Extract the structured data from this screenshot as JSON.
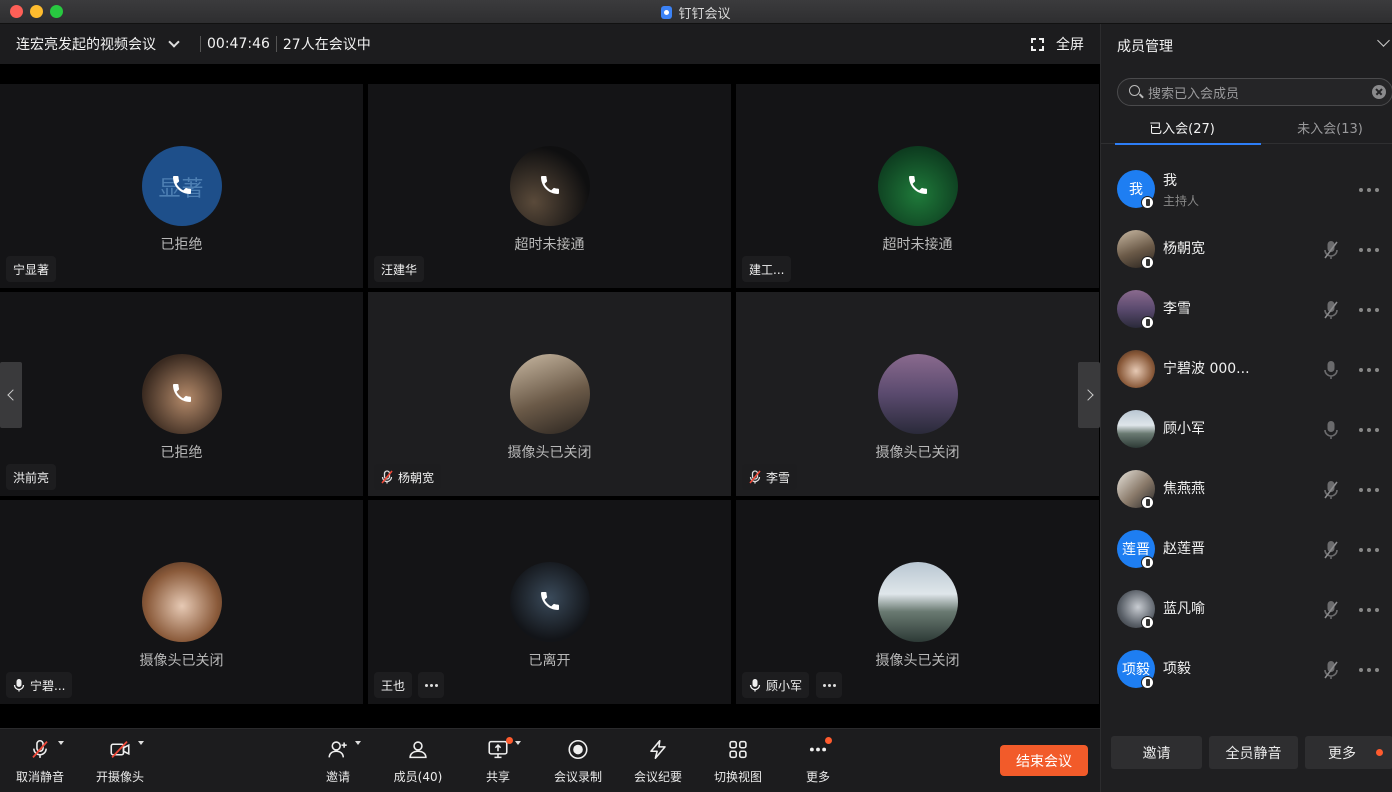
{
  "window": {
    "title": "钉钉会议"
  },
  "header": {
    "meeting_title": "连宏亮发起的视频会议",
    "elapsed": "00:47:46",
    "participants": "27人在会议中",
    "fullscreen_label": "全屏"
  },
  "tiles": [
    {
      "name": "宁显著",
      "status": "已拒绝",
      "avatar_text": "显著"
    },
    {
      "name": "汪建华",
      "status": "超时未接通"
    },
    {
      "name": "建工...",
      "status": "超时未接通"
    },
    {
      "name": "洪前亮",
      "status": "已拒绝"
    },
    {
      "name": "杨朝宽",
      "status": "摄像头已关闭"
    },
    {
      "name": "李雪",
      "status": "摄像头已关闭"
    },
    {
      "name": "宁碧...",
      "status": "摄像头已关闭"
    },
    {
      "name": "王也",
      "status": "已离开"
    },
    {
      "name": "顾小军",
      "status": "摄像头已关闭"
    }
  ],
  "toolbar": {
    "mute": "取消静音",
    "camera": "开摄像头",
    "invite": "邀请",
    "members": "成员(40)",
    "share": "共享",
    "record": "会议录制",
    "minutes": "会议纪要",
    "view": "切换视图",
    "more": "更多",
    "end": "结束会议"
  },
  "panel": {
    "title": "成员管理",
    "search_placeholder": "搜索已入会成员",
    "tab_joined": "已入会(27)",
    "tab_not_joined": "未入会(13)",
    "members": [
      {
        "name": "我",
        "sub": "主持人",
        "avatar_text": "我"
      },
      {
        "name": "杨朝宽"
      },
      {
        "name": "李雪"
      },
      {
        "name": "宁碧波 000..."
      },
      {
        "name": "顾小军"
      },
      {
        "name": "焦燕燕"
      },
      {
        "name": "赵莲晋",
        "avatar_text": "莲晋"
      },
      {
        "name": "蓝凡喻"
      },
      {
        "name": "项毅",
        "avatar_text": "项毅"
      }
    ],
    "btn_invite": "邀请",
    "btn_mute_all": "全员静音",
    "btn_more": "更多"
  },
  "colors": {
    "accent": "#2d7ef7",
    "end_button": "#f25b2a",
    "background": "#1a1a1c"
  }
}
